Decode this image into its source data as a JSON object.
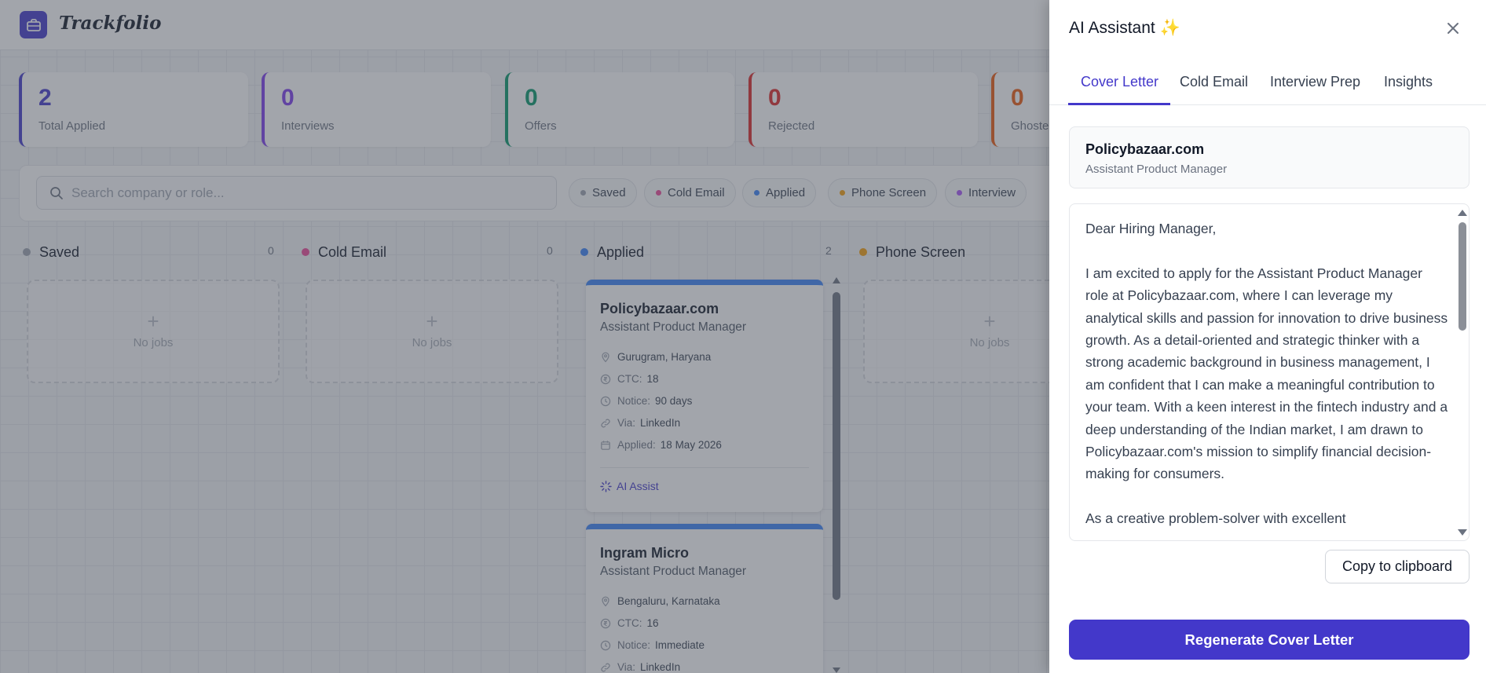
{
  "app": {
    "brand": "Trackfolio",
    "logo_icon": "briefcase-icon"
  },
  "stats": [
    {
      "value": "2",
      "label": "Total Applied",
      "color": "#4338ca"
    },
    {
      "value": "0",
      "label": "Interviews",
      "color": "#7c3aed"
    },
    {
      "value": "0",
      "label": "Offers",
      "color": "#059669"
    },
    {
      "value": "0",
      "label": "Rejected",
      "color": "#dc2626"
    },
    {
      "value": "0",
      "label": "Ghosted",
      "color": "#ea580c"
    }
  ],
  "search": {
    "placeholder": "Search company or role..."
  },
  "filters": [
    {
      "label": "Saved",
      "color": "#9ca3af"
    },
    {
      "label": "Cold Email",
      "color": "#ec4899"
    },
    {
      "label": "Applied",
      "color": "#3b82f6"
    },
    {
      "label": "Phone Screen",
      "color": "#f59e0b"
    },
    {
      "label": "Interview",
      "color": "#a855f7"
    }
  ],
  "columns": [
    {
      "title": "Saved",
      "count": "0",
      "color": "#9ca3af",
      "empty": "No jobs"
    },
    {
      "title": "Cold Email",
      "count": "0",
      "color": "#ec4899",
      "empty": "No jobs"
    },
    {
      "title": "Applied",
      "count": "2",
      "color": "#3b82f6"
    },
    {
      "title": "Phone Screen",
      "count": "",
      "color": "#f59e0b",
      "empty": "No jobs"
    }
  ],
  "cards": [
    {
      "company": "Policybazaar.com",
      "role": "Assistant Product Manager",
      "location": "Gurugram, Haryana",
      "ctc_label": "CTC:",
      "ctc": "18",
      "notice_label": "Notice:",
      "notice": "90 days",
      "via_label": "Via:",
      "via": "LinkedIn",
      "applied_label": "Applied:",
      "applied": "18 May 2026",
      "ai_label": "AI Assist"
    },
    {
      "company": "Ingram Micro",
      "role": "Assistant Product Manager",
      "location": "Bengaluru, Karnataka",
      "ctc_label": "CTC:",
      "ctc": "16",
      "notice_label": "Notice:",
      "notice": "Immediate",
      "via_label": "Via:",
      "via": "LinkedIn"
    }
  ],
  "panel": {
    "title": "AI Assistant ✨",
    "tabs": [
      "Cover Letter",
      "Cold Email",
      "Interview Prep",
      "Insights"
    ],
    "active_tab": "Cover Letter",
    "job": {
      "company": "Policybazaar.com",
      "role": "Assistant Product Manager"
    },
    "letter": {
      "greeting": "Dear Hiring Manager,",
      "para1": "I am excited to apply for the Assistant Product Manager role at Policybazaar.com, where I can leverage my analytical skills and passion for innovation to drive business growth. As a detail-oriented and strategic thinker with a strong academic background in business management, I am confident that I can make a meaningful contribution to your team. With a keen interest in the fintech industry and a deep understanding of the Indian market, I am drawn to Policybazaar.com's mission to simplify financial decision-making for consumers.",
      "para2": "As a creative problem-solver with excellent"
    },
    "copy_label": "Copy to clipboard",
    "regenerate_label": "Regenerate Cover Letter",
    "accent": "#4338ca"
  }
}
